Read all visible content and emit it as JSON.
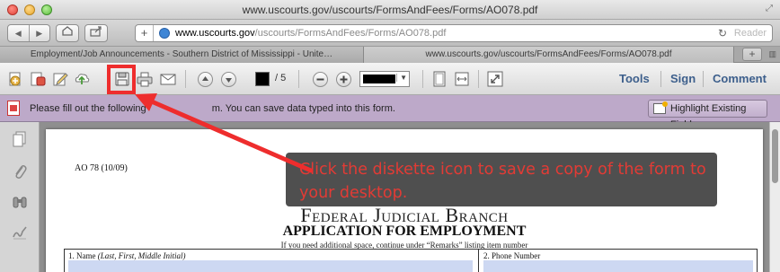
{
  "window": {
    "title": "www.uscourts.gov/uscourts/FormsAndFees/Forms/AO078.pdf"
  },
  "address_bar": {
    "url_host": "www.uscourts.gov",
    "url_path": "/uscourts/FormsAndFees/Forms/AO078.pdf",
    "reader_label": "Reader"
  },
  "tabs": [
    {
      "label": "Employment/Job Announcements - Southern District of Mississippi - Unite…",
      "active": false
    },
    {
      "label": "www.uscourts.gov/uscourts/FormsAndFees/Forms/AO078.pdf",
      "active": true
    }
  ],
  "toolbar": {
    "page_total": "/ 5",
    "tools_label": "Tools",
    "sign_label": "Sign",
    "comment_label": "Comment",
    "icons": [
      "create-pdf-icon",
      "share-icon",
      "edit-icon",
      "upload-icon",
      "save-icon",
      "print-icon",
      "email-icon",
      "prev-page-icon",
      "next-page-icon",
      "zoom-out-icon",
      "zoom-in-icon",
      "fit-page-icon",
      "fit-width-icon",
      "fullscreen-icon"
    ]
  },
  "form_bar": {
    "message_before": "Please fill out the following ",
    "message_after": "m. You can save data typed into this form.",
    "highlight_button": "Highlight Existing Fields"
  },
  "document": {
    "form_id": "AO 78 (10/09)",
    "agency": "Federal Judicial Branch",
    "title": "APPLICATION FOR EMPLOYMENT",
    "subtitle": "If you need additional space, continue under “Remarks” listing item number",
    "field_1_label": "1.  Name ",
    "field_1_hint": "(Last, First, Middle Initial)",
    "field_2_label": "2.  Phone Number"
  },
  "annotation": {
    "text": "Click the diskette icon to save a copy of the form to your desktop.",
    "color": "#e23b35"
  },
  "colors": {
    "highlight_red": "#ee2d2d",
    "form_bar": "#bda9c9",
    "field_fill": "#cdd8f2",
    "link_blue": "#3d5f8c"
  }
}
